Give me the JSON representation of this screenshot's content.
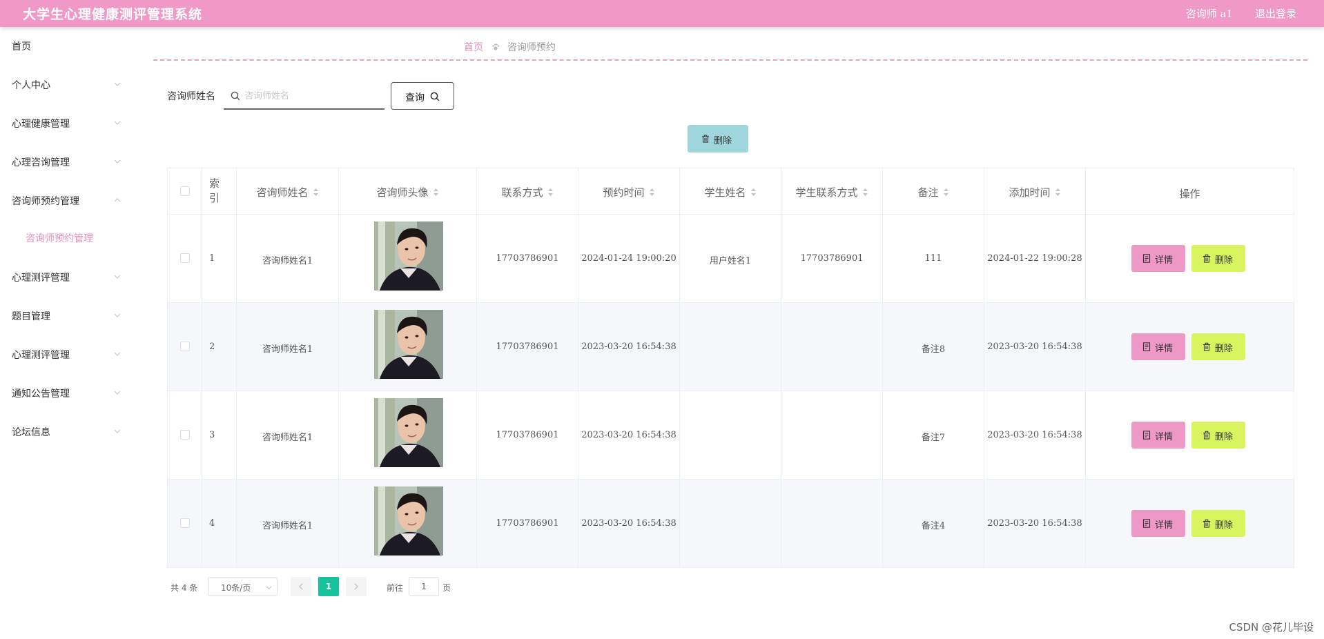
{
  "header": {
    "title": "大学生心理健康测评管理系统",
    "user": "咨询师 a1",
    "logout": "退出登录"
  },
  "sidebar": {
    "items": [
      {
        "label": "首页"
      },
      {
        "label": "个人中心"
      },
      {
        "label": "心理健康管理"
      },
      {
        "label": "心理咨询管理"
      },
      {
        "label": "咨询师预约管理"
      },
      {
        "label": "心理测评管理"
      },
      {
        "label": "题目管理"
      },
      {
        "label": "心理测评管理"
      },
      {
        "label": "通知公告管理"
      },
      {
        "label": "论坛信息"
      }
    ],
    "submenu": {
      "label": "咨询师预约管理"
    }
  },
  "breadcrumb": {
    "home": "首页",
    "current": "咨询师预约"
  },
  "search": {
    "label": "咨询师姓名",
    "placeholder": "咨询师姓名",
    "value": "",
    "query_label": "查询"
  },
  "toolbar": {
    "delete_label": "删除"
  },
  "table": {
    "headers": {
      "index": "索引",
      "name": "咨询师姓名",
      "avatar": "咨询师头像",
      "phone": "联系方式",
      "time": "预约时间",
      "student": "学生姓名",
      "student_phone": "学生联系方式",
      "note": "备注",
      "added": "添加时间",
      "ops": "操作"
    },
    "rows": [
      {
        "index": "1",
        "name": "咨询师姓名1",
        "phone": "17703786901",
        "time": "2024-01-24 19:00:20",
        "student": "用户姓名1",
        "student_phone": "17703786901",
        "note": "111",
        "added": "2024-01-22 19:00:28"
      },
      {
        "index": "2",
        "name": "咨询师姓名1",
        "phone": "17703786901",
        "time": "2023-03-20 16:54:38",
        "student": "",
        "student_phone": "",
        "note": "备注8",
        "added": "2023-03-20 16:54:38"
      },
      {
        "index": "3",
        "name": "咨询师姓名1",
        "phone": "17703786901",
        "time": "2023-03-20 16:54:38",
        "student": "",
        "student_phone": "",
        "note": "备注7",
        "added": "2023-03-20 16:54:38"
      },
      {
        "index": "4",
        "name": "咨询师姓名1",
        "phone": "17703786901",
        "time": "2023-03-20 16:54:38",
        "student": "",
        "student_phone": "",
        "note": "备注4",
        "added": "2023-03-20 16:54:38"
      }
    ],
    "detail_label": "详情",
    "delete_label": "删除"
  },
  "pagination": {
    "total": "共 4 条",
    "page_size": "10条/页",
    "current": "1",
    "goto_label": "前往",
    "goto_value": "1",
    "page_unit": "页"
  },
  "watermark": "CSDN @花儿毕设",
  "colors": {
    "header": "#f098c6",
    "accent_pink": "#e28fbe",
    "detail_button": "#ee98c6",
    "delete_button": "#d8f55f",
    "top_delete": "#9fd6dc",
    "pager_active": "#17c39c"
  }
}
